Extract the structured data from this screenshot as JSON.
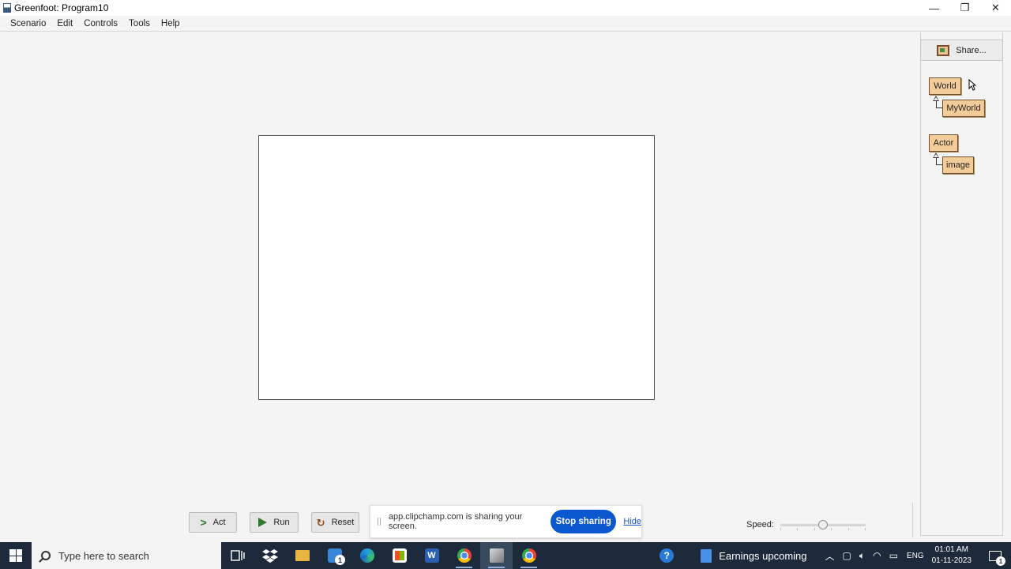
{
  "window": {
    "title": "Greenfoot: Program10",
    "minimize_glyph": "—",
    "restore_glyph": "❐",
    "close_glyph": "✕"
  },
  "menu": {
    "items": [
      {
        "label": "Scenario"
      },
      {
        "label": "Edit"
      },
      {
        "label": "Controls"
      },
      {
        "label": "Tools"
      },
      {
        "label": "Help"
      }
    ]
  },
  "class_panel": {
    "share_label": "Share...",
    "classes": {
      "world": "World",
      "my_world": "MyWorld",
      "actor": "Actor",
      "image": "image"
    }
  },
  "controls": {
    "act_label": "Act",
    "run_label": "Run",
    "reset_label": "Reset",
    "speed_label": "Speed:",
    "speed_value": 0.5
  },
  "screen_share": {
    "message": "app.clipchamp.com is sharing your screen.",
    "stop_label": "Stop sharing",
    "hide_label": "Hide",
    "accent": "#0b57d0"
  },
  "taskbar": {
    "search_placeholder": "Type here to search",
    "mail_badge": "1",
    "news_text": "Earnings upcoming",
    "language": "ENG",
    "time": "01:01 AM",
    "date": "01-11-2023",
    "notification_count": "1",
    "background": "#1c2a3b"
  },
  "colors": {
    "class_box": "#f4cc9a",
    "run_green": "#2f7a2f"
  }
}
